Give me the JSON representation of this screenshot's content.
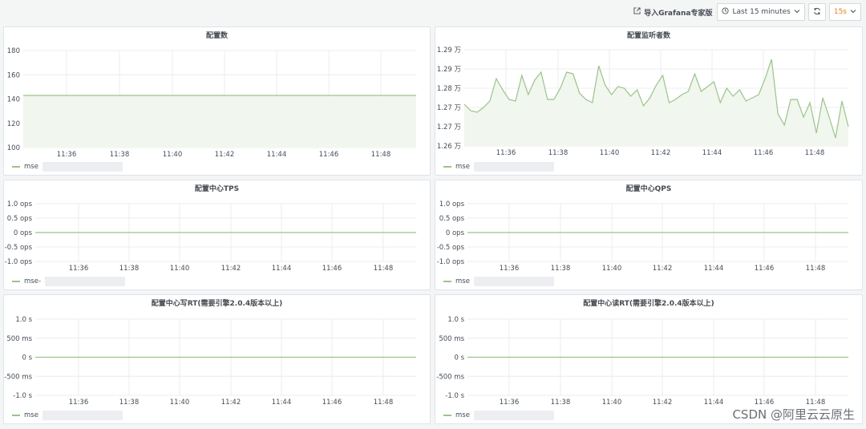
{
  "toolbar": {
    "import_label": "导入Grafana专家版",
    "timerange_label": "Last 15 minutes",
    "refresh_interval": "15s"
  },
  "colors": {
    "series": "#9ac48a",
    "fill": "#f1f6ee"
  },
  "watermark": "CSDN @阿里云云原生",
  "panels": [
    {
      "title": "配置数",
      "legend": "mse"
    },
    {
      "title": "配置监听者数",
      "legend": "mse"
    },
    {
      "title": "配置中心TPS",
      "legend": "mse-"
    },
    {
      "title": "配置中心QPS",
      "legend": "mse"
    },
    {
      "title": "配置中心写RT(需要引擎2.0.4版本以上)",
      "legend": "mse"
    },
    {
      "title": "配置中心读RT(需要引擎2.0.4版本以上)",
      "legend": "mse"
    }
  ],
  "chart_data": [
    {
      "type": "area",
      "title": "配置数",
      "x": [
        "11:34",
        "11:49"
      ],
      "x_ticks": [
        "11:36",
        "11:38",
        "11:40",
        "11:42",
        "11:44",
        "11:46",
        "11:48"
      ],
      "y_ticks": [
        "180",
        "160",
        "140",
        "120",
        "100"
      ],
      "ylim": [
        100,
        180
      ],
      "series": [
        {
          "values": [
            143,
            143
          ]
        }
      ]
    },
    {
      "type": "area",
      "title": "配置监听者数",
      "x_ticks": [
        "11:36",
        "11:38",
        "11:40",
        "11:42",
        "11:44",
        "11:46",
        "11:48"
      ],
      "y_ticks": [
        "1.29 万",
        "1.29 万",
        "1.28 万",
        "1.27 万",
        "1.27 万",
        "1.26 万"
      ],
      "ylim": [
        12600,
        12900
      ],
      "series": [
        {
          "values": [
            12730,
            12710,
            12705,
            12720,
            12740,
            12810,
            12775,
            12745,
            12740,
            12820,
            12760,
            12805,
            12830,
            12745,
            12745,
            12780,
            12830,
            12825,
            12765,
            12745,
            12735,
            12850,
            12790,
            12760,
            12785,
            12780,
            12755,
            12775,
            12725,
            12750,
            12790,
            12820,
            12735,
            12745,
            12760,
            12770,
            12825,
            12770,
            12785,
            12800,
            12735,
            12780,
            12755,
            12775,
            12740,
            12750,
            12760,
            12810,
            12870,
            12700,
            12665,
            12745,
            12745,
            12690,
            12735,
            12640,
            12750,
            12690,
            12625,
            12740,
            12660
          ]
        }
      ]
    },
    {
      "type": "line",
      "title": "配置中心TPS",
      "x_ticks": [
        "11:36",
        "11:38",
        "11:40",
        "11:42",
        "11:44",
        "11:46",
        "11:48"
      ],
      "y_ticks": [
        "1.0 ops",
        "0.5 ops",
        "0 ops",
        "-0.5 ops",
        "-1.0 ops"
      ],
      "ylim": [
        -1,
        1
      ],
      "series": [
        {
          "values": [
            0,
            0
          ]
        }
      ]
    },
    {
      "type": "line",
      "title": "配置中心QPS",
      "x_ticks": [
        "11:36",
        "11:38",
        "11:40",
        "11:42",
        "11:44",
        "11:46",
        "11:48"
      ],
      "y_ticks": [
        "1.0 ops",
        "0.5 ops",
        "0 ops",
        "-0.5 ops",
        "-1.0 ops"
      ],
      "ylim": [
        -1,
        1
      ],
      "series": [
        {
          "values": [
            0,
            0
          ]
        }
      ]
    },
    {
      "type": "line",
      "title": "配置中心写RT(需要引擎2.0.4版本以上)",
      "x_ticks": [
        "11:36",
        "11:38",
        "11:40",
        "11:42",
        "11:44",
        "11:46",
        "11:48"
      ],
      "y_ticks": [
        "1.0 s",
        "500 ms",
        "0 s",
        "-500 ms",
        "-1.0 s"
      ],
      "ylim": [
        -1,
        1
      ],
      "series": [
        {
          "values": [
            0,
            0
          ]
        }
      ]
    },
    {
      "type": "line",
      "title": "配置中心读RT(需要引擎2.0.4版本以上)",
      "x_ticks": [
        "11:36",
        "11:38",
        "11:40",
        "11:42",
        "11:44",
        "11:46",
        "11:48"
      ],
      "y_ticks": [
        "1.0 s",
        "500 ms",
        "0 s",
        "-500 ms",
        "-1.0 s"
      ],
      "ylim": [
        -1,
        1
      ],
      "series": [
        {
          "values": [
            0,
            0
          ]
        }
      ]
    }
  ]
}
